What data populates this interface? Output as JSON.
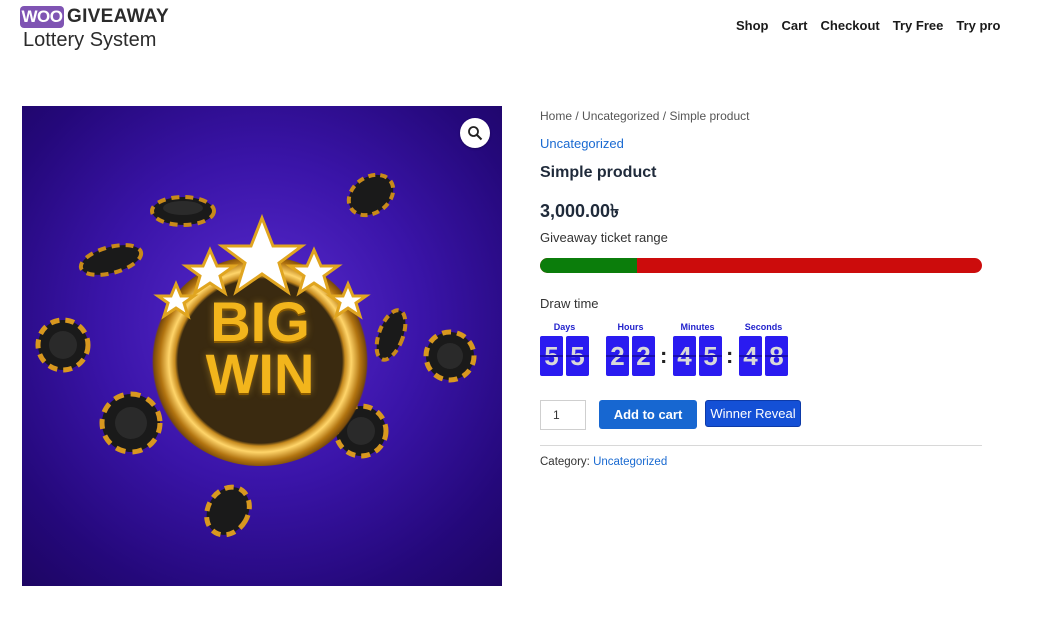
{
  "header": {
    "logo": {
      "badge": "WOO",
      "brand": "GIVEAWAY",
      "subtitle": "Lottery System"
    },
    "nav": [
      "Shop",
      "Cart",
      "Checkout",
      "Try Free",
      "Try pro"
    ]
  },
  "gallery": {
    "zoom_icon": "magnifier-icon",
    "image_text": "BIG WIN",
    "image_colors": {
      "background": "#3a14a8",
      "gold": "#f2b51c"
    }
  },
  "product": {
    "breadcrumb": [
      "Home",
      "Uncategorized",
      "Simple product"
    ],
    "breadcrumb_separator": " / ",
    "category_link": "Uncategorized",
    "title": "Simple product",
    "price": "3,000.00৳",
    "ticket_range_label": "Giveaway ticket range",
    "ticket_range_progress": 0.22,
    "progress_colors": {
      "sold": "#0b7d0b",
      "remaining": "#cc0c0c"
    },
    "draw_time_label": "Draw time",
    "countdown": {
      "days": {
        "label": "Days",
        "digits": [
          "5",
          "5"
        ]
      },
      "hours": {
        "label": "Hours",
        "digits": [
          "2",
          "2"
        ]
      },
      "minutes": {
        "label": "Minutes",
        "digits": [
          "4",
          "5"
        ]
      },
      "seconds": {
        "label": "Seconds",
        "digits": [
          "4",
          "8"
        ]
      },
      "separator": ":"
    },
    "quantity": "1",
    "add_to_cart_label": "Add to cart",
    "winner_reveal_label": "Winner Reveal",
    "meta": {
      "category_label": "Category:",
      "category_value": "Uncategorized"
    },
    "accent_color": "#1767d1"
  }
}
